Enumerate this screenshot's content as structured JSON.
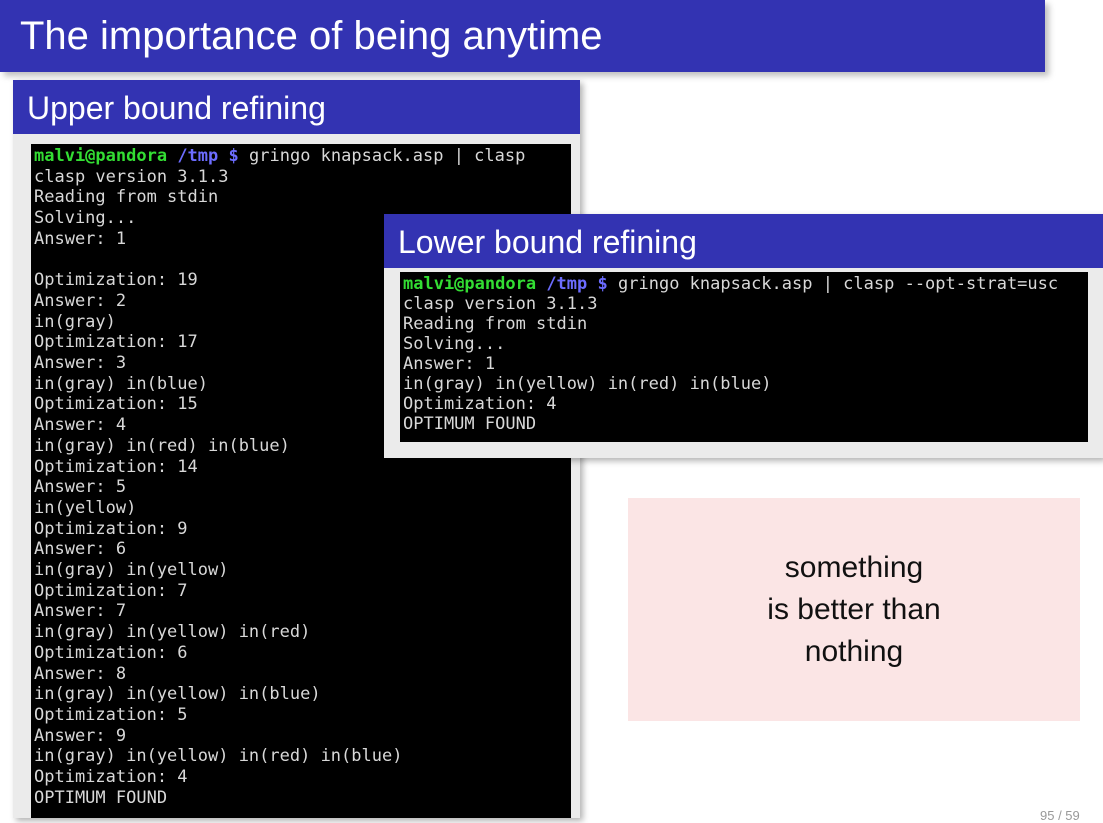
{
  "slide": {
    "title": "The importance of being anytime",
    "page_number": "95 / 59"
  },
  "upper_block": {
    "heading": "Upper bound refining",
    "prompt": {
      "user": "malvi@pandora",
      "dir": "/tmp",
      "symbol": "$",
      "command": "gringo knapsack.asp | clasp"
    },
    "lines": [
      "clasp version 3.1.3",
      "Reading from stdin",
      "Solving...",
      "Answer: 1",
      "",
      "Optimization: 19",
      "Answer: 2",
      "in(gray)",
      "Optimization: 17",
      "Answer: 3",
      "in(gray) in(blue)",
      "Optimization: 15",
      "Answer: 4",
      "in(gray) in(red) in(blue)",
      "Optimization: 14",
      "Answer: 5",
      "in(yellow)",
      "Optimization: 9",
      "Answer: 6",
      "in(gray) in(yellow)",
      "Optimization: 7",
      "Answer: 7",
      "in(gray) in(yellow) in(red)",
      "Optimization: 6",
      "Answer: 8",
      "in(gray) in(yellow) in(blue)",
      "Optimization: 5",
      "Answer: 9",
      "in(gray) in(yellow) in(red) in(blue)",
      "Optimization: 4",
      "OPTIMUM FOUND"
    ]
  },
  "lower_block": {
    "heading": "Lower bound refining",
    "prompt": {
      "user": "malvi@pandora",
      "dir": "/tmp",
      "symbol": "$",
      "command": "gringo knapsack.asp | clasp --opt-strat=usc"
    },
    "lines": [
      "clasp version 3.1.3",
      "Reading from stdin",
      "Solving...",
      "Answer: 1",
      "in(gray) in(yellow) in(red) in(blue)",
      "Optimization: 4",
      "OPTIMUM FOUND"
    ]
  },
  "note": {
    "lines": [
      "something",
      "is better than",
      "nothing"
    ]
  },
  "colors": {
    "title_bg": "#3333b2",
    "terminal_bg": "#000000",
    "prompt_user": "#33dd33",
    "prompt_dir": "#6c6cff",
    "note_bg": "#fbe5e5"
  }
}
